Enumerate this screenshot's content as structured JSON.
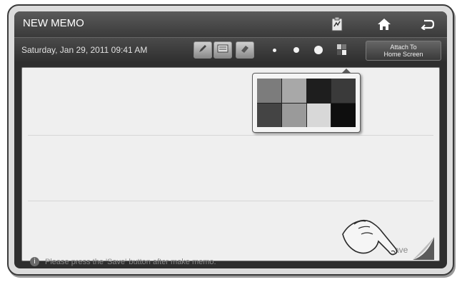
{
  "header": {
    "title": "NEW MEMO",
    "icons": [
      "clipboard-icon",
      "home-icon",
      "back-icon"
    ]
  },
  "toolbar": {
    "datetime": "Saturday, Jan 29, 2011 09:41 AM",
    "tools": [
      "pen-icon",
      "keyboard-icon",
      "eraser-icon"
    ],
    "brush_sizes": [
      "small",
      "medium",
      "large",
      "x-large"
    ],
    "palette_toggle": "palette-icon",
    "attach_label_line1": "Attach To",
    "attach_label_line2": "Home Screen"
  },
  "palette": {
    "colors": [
      "#7c7c7c",
      "#a8a8a8",
      "#1e1e1e",
      "#3a3a3a",
      "#444444",
      "#9a9a9a",
      "#d8d8d8",
      "#0e0e0e"
    ]
  },
  "footer": {
    "hint": "Please press the 'Save' button after make memo.",
    "save_label": "Save"
  }
}
